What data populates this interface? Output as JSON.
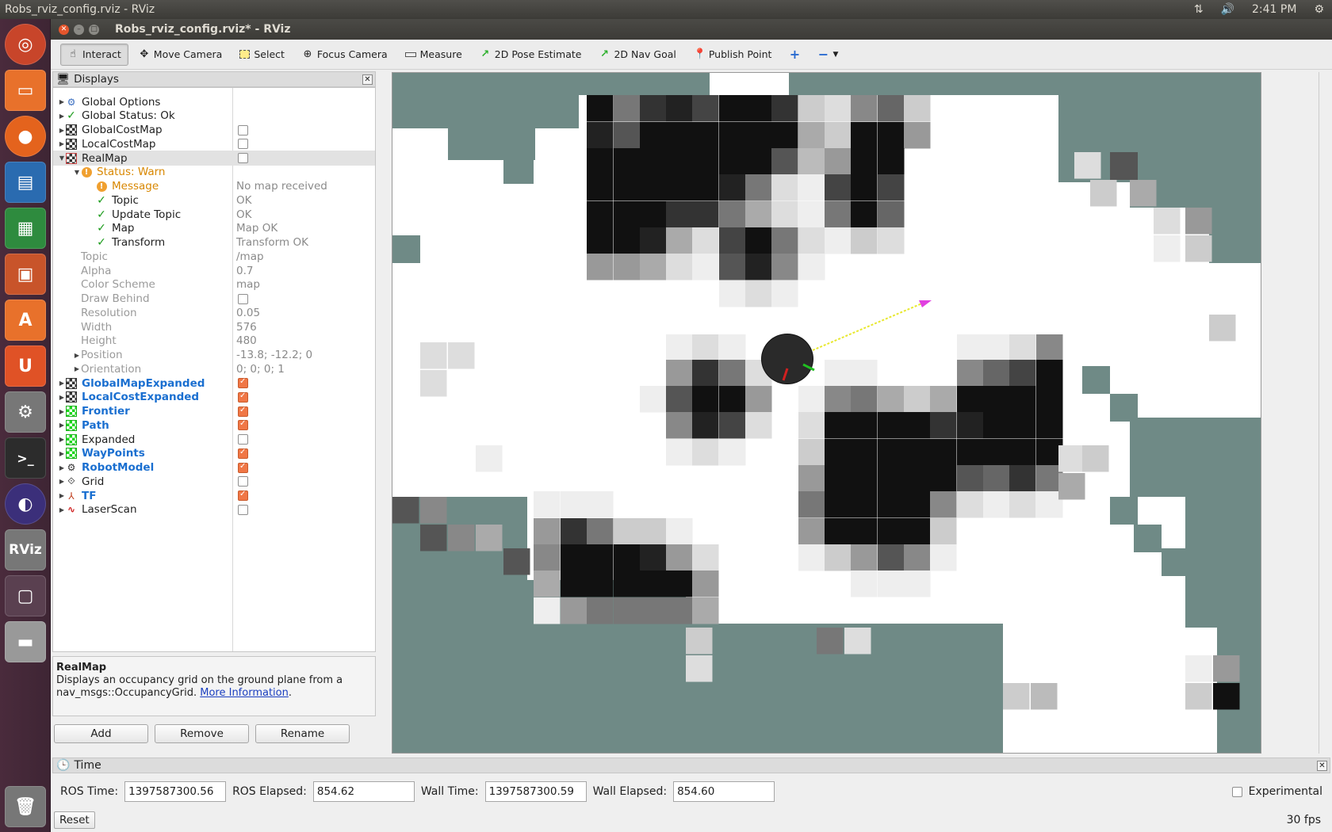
{
  "panel": {
    "window_title": "Robs_rviz_config.rviz - RViz",
    "clock": "2:41 PM",
    "net_icon": "network-icon",
    "vol_icon": "volume-icon",
    "gear_icon": "gear-icon"
  },
  "launcher": {
    "rviz_label": "RViz"
  },
  "window": {
    "title": "Robs_rviz_config.rviz* - RViz"
  },
  "toolbar": {
    "interact": "Interact",
    "move_camera": "Move Camera",
    "select": "Select",
    "focus_camera": "Focus Camera",
    "measure": "Measure",
    "pose_estimate": "2D Pose Estimate",
    "nav_goal": "2D Nav Goal",
    "publish_point": "Publish Point"
  },
  "displays": {
    "header": "Displays",
    "rows": [
      {
        "label": "Global Options"
      },
      {
        "label": "Global Status: Ok"
      },
      {
        "label": "GlobalCostMap"
      },
      {
        "label": "LocalCostMap"
      },
      {
        "label": "RealMap"
      },
      {
        "label": "Status: Warn"
      },
      {
        "label": "Message",
        "value": "No map received"
      },
      {
        "label": "Topic",
        "value": "OK"
      },
      {
        "label": "Update Topic",
        "value": "OK"
      },
      {
        "label": "Map",
        "value": "Map OK"
      },
      {
        "label": "Transform",
        "value": "Transform OK"
      },
      {
        "label": "Topic",
        "value": "/map"
      },
      {
        "label": "Alpha",
        "value": "0.7"
      },
      {
        "label": "Color Scheme",
        "value": "map"
      },
      {
        "label": "Draw Behind"
      },
      {
        "label": "Resolution",
        "value": "0.05"
      },
      {
        "label": "Width",
        "value": "576"
      },
      {
        "label": "Height",
        "value": "480"
      },
      {
        "label": "Position",
        "value": "-13.8; -12.2; 0"
      },
      {
        "label": "Orientation",
        "value": "0; 0; 0; 1"
      },
      {
        "label": "GlobalMapExpanded"
      },
      {
        "label": "LocalCostExpanded"
      },
      {
        "label": "Frontier"
      },
      {
        "label": "Path"
      },
      {
        "label": "Expanded"
      },
      {
        "label": "WayPoints"
      },
      {
        "label": "RobotModel"
      },
      {
        "label": "Grid"
      },
      {
        "label": "TF"
      },
      {
        "label": "LaserScan"
      }
    ],
    "checked": [
      false,
      false,
      false,
      false,
      false,
      false,
      false,
      false,
      false,
      false,
      false,
      false,
      false,
      false,
      false,
      false,
      false,
      false,
      false,
      false,
      true,
      true,
      true,
      true,
      false,
      true,
      true,
      false,
      true,
      false
    ]
  },
  "description": {
    "title": "RealMap",
    "text": "Displays an occupancy grid on the ground plane from a nav_msgs::OccupancyGrid.",
    "link": "More Information",
    "period": "."
  },
  "buttons": {
    "add": "Add",
    "remove": "Remove",
    "rename": "Rename"
  },
  "time": {
    "header": "Time",
    "ros_time_label": "ROS Time:",
    "ros_time": "1397587300.56",
    "ros_elapsed_label": "ROS Elapsed:",
    "ros_elapsed": "854.62",
    "wall_time_label": "Wall Time:",
    "wall_time": "1397587300.59",
    "wall_elapsed_label": "Wall Elapsed:",
    "wall_elapsed": "854.60",
    "experimental": "Experimental",
    "reset": "Reset",
    "fps": "30 fps"
  },
  "colors": {
    "map_teal": "#6f8a86",
    "checkbox_on": "#f07746",
    "link_blue": "#1a6fd0",
    "warn": "#d88700"
  }
}
